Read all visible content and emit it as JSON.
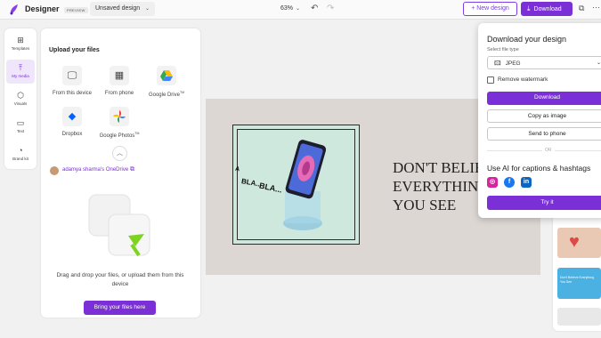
{
  "topbar": {
    "app_name": "Designer",
    "preview_tag": "PREVIEW",
    "doc_name": "Unsaved design",
    "zoom": "63%",
    "new_design": "+ New design",
    "download": "Download"
  },
  "rail": {
    "items": [
      {
        "label": "Templates",
        "icon": "templates-icon"
      },
      {
        "label": "My media",
        "icon": "upload-icon",
        "active": true
      },
      {
        "label": "Visuals",
        "icon": "visuals-icon"
      },
      {
        "label": "Text",
        "icon": "text-icon"
      },
      {
        "label": "Brand kit",
        "icon": "brand-kit-icon"
      }
    ]
  },
  "media": {
    "title": "Upload your files",
    "sources": [
      {
        "label": "From this device",
        "icon": "monitor-icon"
      },
      {
        "label": "From phone",
        "icon": "qr-code-icon"
      },
      {
        "label": "Google Drive",
        "sup": "TM",
        "icon": "google-drive-icon"
      },
      {
        "label": "Dropbox",
        "icon": "dropbox-icon"
      },
      {
        "label": "Google Photos",
        "sup": "TM",
        "icon": "google-photos-icon"
      }
    ],
    "account": "adamya sharma's OneDrive",
    "drop_text": "Drag and drop your files, or upload them from this device",
    "bring_files": "Bring your files here"
  },
  "canvas": {
    "bla1": "A",
    "bla2": "BLA...",
    "bla3": "BLA...",
    "line1": "DON'T BELIE",
    "line2": "EVERYTHIN",
    "line3": "YOU SEE"
  },
  "thumbnails": {
    "thumb2_text": "Don't Believe Everything You See"
  },
  "download_panel": {
    "title": "Download your design",
    "file_type_label": "Select file type",
    "file_type_value": "JPEG",
    "remove_watermark": "Remove watermark",
    "download": "Download",
    "copy_as_image": "Copy as image",
    "send_to_phone": "Send to phone",
    "or": "OR",
    "ai_title": "Use AI for captions & hashtags",
    "try_it": "Try it",
    "social": [
      "instagram",
      "facebook",
      "linkedin"
    ]
  },
  "colors": {
    "accent": "#7b2fd6",
    "canvas_bg": "#ddd7d3",
    "art_bg": "#cfe8de"
  }
}
